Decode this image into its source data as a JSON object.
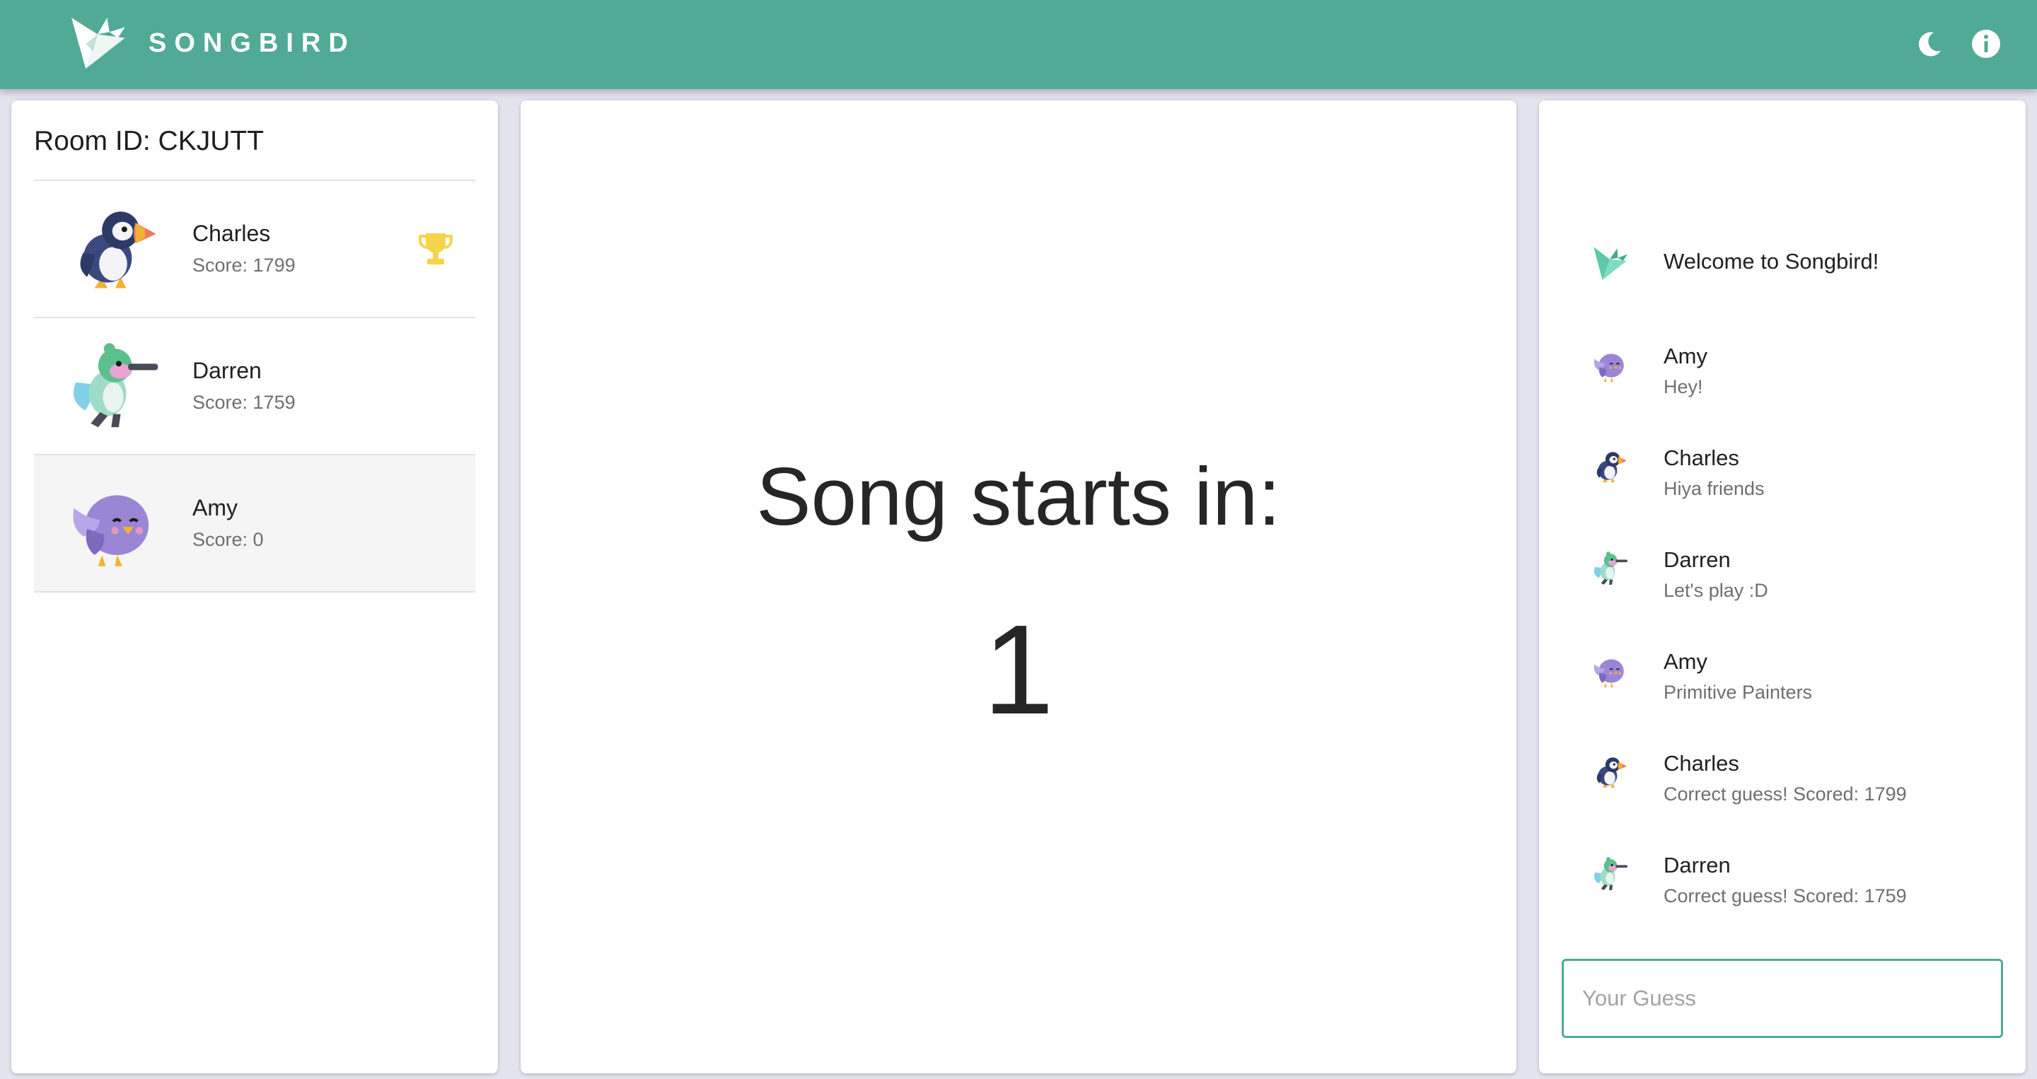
{
  "app": {
    "title": "SONGBIRD",
    "accent_color": "#50aa96",
    "icons": {
      "logo": "origami-bird-logo",
      "theme": "moon-icon",
      "info": "info-icon"
    }
  },
  "room": {
    "label": "Room ID: CKJUTT"
  },
  "players": [
    {
      "name": "Charles",
      "score": "Score: 1799",
      "avatar": "puffin-icon",
      "leader": true
    },
    {
      "name": "Darren",
      "score": "Score: 1759",
      "avatar": "hummingbird-icon",
      "leader": false
    },
    {
      "name": "Amy",
      "score": "Score: 0",
      "avatar": "purple-bird-icon",
      "leader": false
    }
  ],
  "countdown": {
    "label": "Song starts in:",
    "value": "1"
  },
  "chat": {
    "welcome": "Welcome to Songbird!",
    "messages": [
      {
        "author": "Amy",
        "text": "Hey!",
        "icon": "purple-bird-icon"
      },
      {
        "author": "Charles",
        "text": "Hiya friends",
        "icon": "puffin-icon"
      },
      {
        "author": "Darren",
        "text": "Let's play :D",
        "icon": "hummingbird-icon"
      },
      {
        "author": "Amy",
        "text": "Primitive Painters",
        "icon": "purple-bird-icon"
      },
      {
        "author": "Charles",
        "text": "Correct guess! Scored: 1799",
        "icon": "puffin-icon"
      },
      {
        "author": "Darren",
        "text": "Correct guess! Scored: 1759",
        "icon": "hummingbird-icon"
      }
    ],
    "guess_placeholder": "Your Guess",
    "guess_value": ""
  }
}
